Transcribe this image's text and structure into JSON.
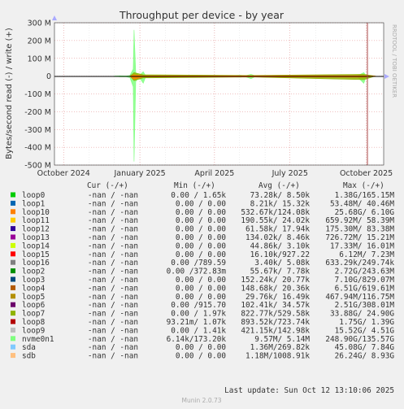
{
  "header": {
    "title": "Throughput per device - by year",
    "side_text": "RRDTOOL / TOBI OETIKER"
  },
  "colors": {
    "background": "#f0f0f0",
    "plot_background": "#ffffff",
    "grid": "#e08080",
    "zero_line": "#000000",
    "border": "#333333"
  },
  "legend_header": {
    "cur": "Cur (-/+)",
    "min": "Min (-/+)",
    "avg": "Avg (-/+)",
    "max": "Max (-/+)"
  },
  "legend": [
    {
      "name": "loop0",
      "color": "#00cc00",
      "cur": "-nan /  -nan",
      "min": "0.00 /  1.65k",
      "avg": "73.28k/  8.50k",
      "max": "1.38G/165.15M"
    },
    {
      "name": "loop1",
      "color": "#0066b3",
      "cur": "-nan /  -nan",
      "min": "0.00 /  0.00",
      "avg": "8.21k/ 15.32k",
      "max": "53.48M/ 40.46M"
    },
    {
      "name": "loop10",
      "color": "#ff8000",
      "cur": "-nan /  -nan",
      "min": "0.00 /  0.00",
      "avg": "532.67k/124.08k",
      "max": "25.68G/  6.10G"
    },
    {
      "name": "loop11",
      "color": "#ffcc00",
      "cur": "-nan /  -nan",
      "min": "0.00 /  0.00",
      "avg": "190.55k/ 24.02k",
      "max": "659.92M/ 58.39M"
    },
    {
      "name": "loop12",
      "color": "#330099",
      "cur": "-nan /  -nan",
      "min": "0.00 /  0.00",
      "avg": "61.58k/ 17.94k",
      "max": "175.30M/ 83.38M"
    },
    {
      "name": "loop13",
      "color": "#990099",
      "cur": "-nan /  -nan",
      "min": "0.00 /  0.00",
      "avg": "134.02k/  8.46k",
      "max": "726.72M/ 15.21M"
    },
    {
      "name": "loop14",
      "color": "#ccff00",
      "cur": "-nan /  -nan",
      "min": "0.00 /  0.00",
      "avg": "44.86k/  3.10k",
      "max": "17.33M/ 16.01M"
    },
    {
      "name": "loop15",
      "color": "#ff0000",
      "cur": "-nan /  -nan",
      "min": "0.00 /  0.00",
      "avg": "16.10k/927.22",
      "max": "6.12M/  7.23M"
    },
    {
      "name": "loop16",
      "color": "#808080",
      "cur": "-nan /  -nan",
      "min": "0.00 /789.59",
      "avg": "3.40k/  5.08k",
      "max": "633.29k/249.74k"
    },
    {
      "name": "loop2",
      "color": "#008f00",
      "cur": "-nan /  -nan",
      "min": "0.00 /372.83m",
      "avg": "55.67k/  7.78k",
      "max": "2.72G/243.63M"
    },
    {
      "name": "loop3",
      "color": "#00487d",
      "cur": "-nan /  -nan",
      "min": "0.00 /  0.00",
      "avg": "152.24k/ 20.77k",
      "max": "7.10G/829.07M"
    },
    {
      "name": "loop4",
      "color": "#b35a00",
      "cur": "-nan /  -nan",
      "min": "0.00 /  0.00",
      "avg": "148.68k/ 20.36k",
      "max": "6.51G/619.61M"
    },
    {
      "name": "loop5",
      "color": "#b38f00",
      "cur": "-nan /  -nan",
      "min": "0.00 /  0.00",
      "avg": "29.76k/ 16.49k",
      "max": "467.94M/116.75M"
    },
    {
      "name": "loop6",
      "color": "#6b006b",
      "cur": "-nan /  -nan",
      "min": "0.00 /915.70",
      "avg": "102.41k/ 34.57k",
      "max": "2.51G/308.01M"
    },
    {
      "name": "loop7",
      "color": "#8fb300",
      "cur": "-nan /  -nan",
      "min": "0.00 /  1.97k",
      "avg": "822.77k/529.58k",
      "max": "33.88G/ 24.90G"
    },
    {
      "name": "loop8",
      "color": "#b30000",
      "cur": "-nan /  -nan",
      "min": "93.21m/  1.07k",
      "avg": "893.52k/723.74k",
      "max": "1.75G/  1.39G"
    },
    {
      "name": "loop9",
      "color": "#bebebe",
      "cur": "-nan /  -nan",
      "min": "0.00 /  1.41k",
      "avg": "421.15k/142.98k",
      "max": "15.52G/  4.51G"
    },
    {
      "name": "nvme0n1",
      "color": "#80ff80",
      "cur": "-nan /  -nan",
      "min": "6.14k/173.20k",
      "avg": "9.57M/  5.14M",
      "max": "248.90G/135.57G"
    },
    {
      "name": "sda",
      "color": "#80c9ff",
      "cur": "-nan /  -nan",
      "min": "0.00 /  0.00",
      "avg": "1.36M/269.82k",
      "max": "45.08G/  7.84G"
    },
    {
      "name": "sdb",
      "color": "#ffc080",
      "cur": "-nan /  -nan",
      "min": "0.00 /  0.00",
      "avg": "1.18M/1008.91k",
      "max": "26.24G/  8.93G"
    }
  ],
  "footer": {
    "last_update": "Last update: Sun Oct 12 13:10:06 2025",
    "munin": "Munin 2.0.73"
  },
  "chart_data": {
    "type": "area",
    "title": "Throughput per device - by year",
    "ylabel": "Bytes/second read (-) / write (+)",
    "ylim": [
      -500000000,
      300000000
    ],
    "y_ticks": [
      {
        "value": 300000000,
        "label": "300 M"
      },
      {
        "value": 200000000,
        "label": "200 M"
      },
      {
        "value": 100000000,
        "label": "100 M"
      },
      {
        "value": 0,
        "label": "0"
      },
      {
        "value": -100000000,
        "label": "-100 M"
      },
      {
        "value": -200000000,
        "label": "-200 M"
      },
      {
        "value": -300000000,
        "label": "-300 M"
      },
      {
        "value": -400000000,
        "label": "-400 M"
      },
      {
        "value": -500000000,
        "label": "-500 M"
      }
    ],
    "xlim": [
      "2024-09-20",
      "2025-10-22"
    ],
    "x_ticks": [
      {
        "date": "2024-10-01",
        "label": "October 2024"
      },
      {
        "date": "2025-01-01",
        "label": "January 2025"
      },
      {
        "date": "2025-04-01",
        "label": "April 2025"
      },
      {
        "date": "2025-07-01",
        "label": "July 2025"
      },
      {
        "date": "2025-10-01",
        "label": "October 2025"
      }
    ],
    "grid": true,
    "series": [
      {
        "name": "nvme0n1",
        "color": "#80ff80",
        "points": [
          [
            "2024-12-01",
            0,
            0
          ],
          [
            "2024-12-08",
            -4000000,
            2000000
          ],
          [
            "2024-12-15",
            -3000000,
            1000000
          ],
          [
            "2024-12-20",
            -8000000,
            4000000
          ],
          [
            "2024-12-24",
            -60000000,
            40000000
          ],
          [
            "2024-12-25",
            -480000000,
            260000000
          ],
          [
            "2024-12-27",
            -30000000,
            20000000
          ],
          [
            "2024-12-31",
            -5000000,
            3000000
          ],
          [
            "2025-01-05",
            -40000000,
            25000000
          ],
          [
            "2025-01-08",
            -4000000,
            2000000
          ],
          [
            "2025-02-15",
            -2000000,
            1000000
          ],
          [
            "2025-04-10",
            -2000000,
            1000000
          ],
          [
            "2025-05-02",
            -6000000,
            5000000
          ],
          [
            "2025-05-08",
            -3000000,
            2000000
          ],
          [
            "2025-05-15",
            -14000000,
            10000000
          ],
          [
            "2025-05-20",
            -3000000,
            2000000
          ],
          [
            "2025-07-01",
            -2000000,
            1000000
          ],
          [
            "2025-09-20",
            -2000000,
            1000000
          ],
          [
            "2025-09-28",
            -40000000,
            20000000
          ],
          [
            "2025-10-01",
            -3000000,
            2000000
          ],
          [
            "2025-10-12",
            0,
            0
          ]
        ]
      },
      {
        "name": "loop7",
        "color": "#8fb300",
        "points": [
          [
            "2024-12-20",
            0,
            0
          ],
          [
            "2024-12-25",
            -25000000,
            20000000
          ],
          [
            "2025-01-05",
            -10000000,
            8000000
          ],
          [
            "2025-05-15",
            -5000000,
            4000000
          ],
          [
            "2025-09-28",
            -20000000,
            10000000
          ],
          [
            "2025-10-12",
            0,
            0
          ]
        ]
      },
      {
        "name": "loop10",
        "color": "#ff8000",
        "points": [
          [
            "2024-12-20",
            0,
            0
          ],
          [
            "2024-12-25",
            -18000000,
            8000000
          ],
          [
            "2025-01-05",
            -4000000,
            2000000
          ],
          [
            "2025-09-28",
            -6000000,
            3000000
          ],
          [
            "2025-10-12",
            0,
            0
          ]
        ]
      }
    ]
  }
}
